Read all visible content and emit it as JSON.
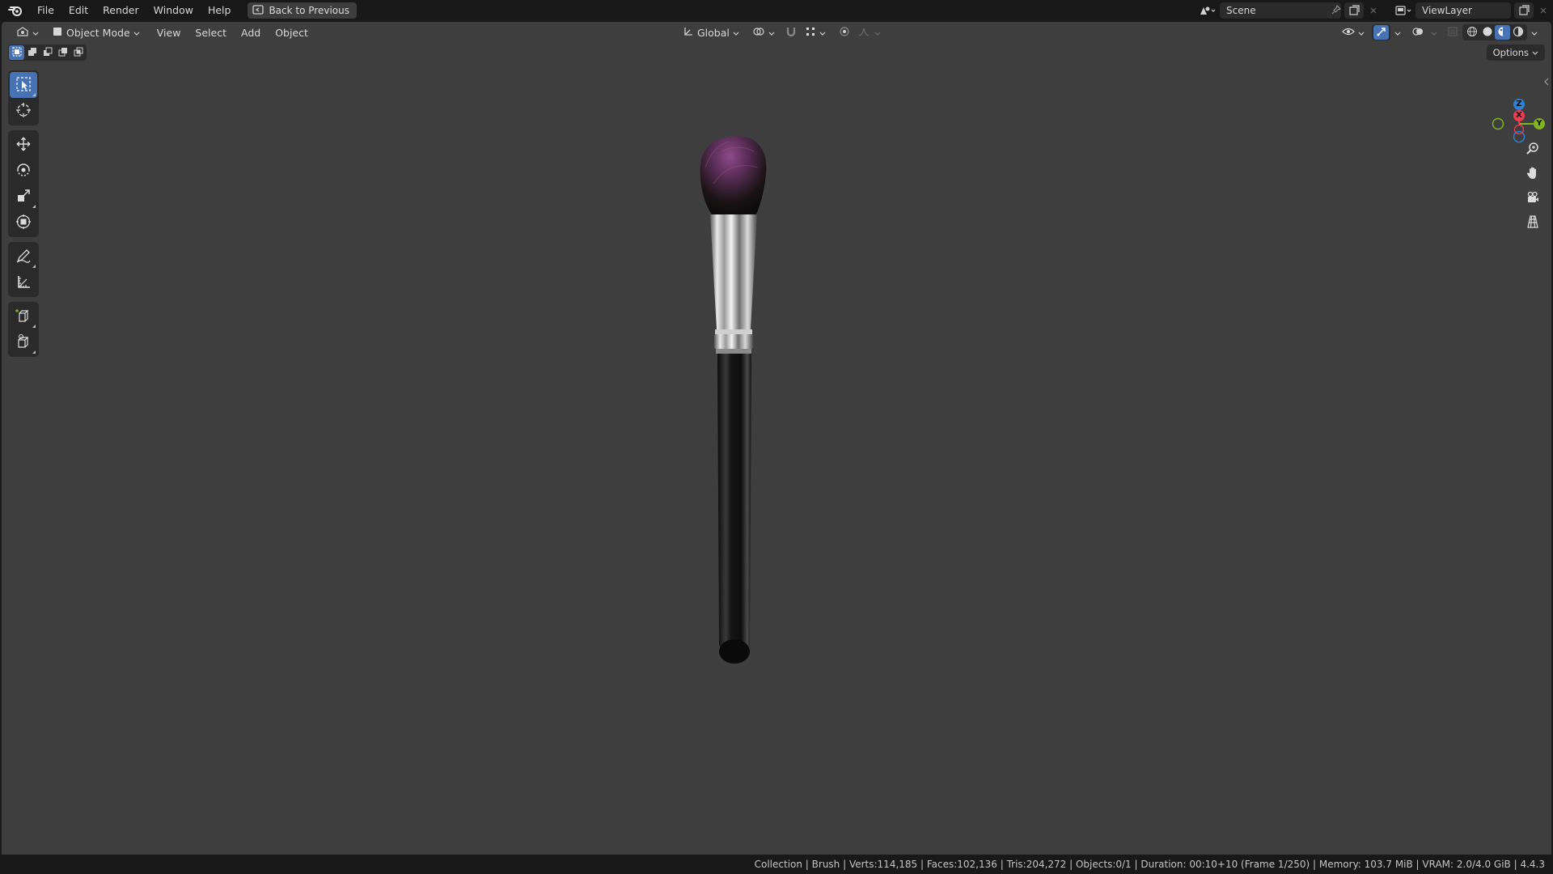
{
  "topbar": {
    "menus": [
      "File",
      "Edit",
      "Render",
      "Window",
      "Help"
    ],
    "back_label": "Back to Previous",
    "scene_name": "Scene",
    "view_layer": "ViewLayer"
  },
  "viewport_header": {
    "mode": "Object Mode",
    "menus": [
      "View",
      "Select",
      "Add",
      "Object"
    ],
    "transform_orientation": "Global",
    "options_label": "Options"
  },
  "gizmo": {
    "axis_x": "X",
    "axis_y": "Y",
    "axis_z": "Z",
    "colors": {
      "x": "#ee3b50",
      "y": "#7fb51f",
      "z": "#2f7fd6"
    }
  },
  "toolbar_tools": [
    "select-box",
    "cursor",
    "move",
    "rotate",
    "scale",
    "transform",
    "annotate",
    "measure",
    "add-cube",
    "add-extrude"
  ],
  "statusbar": {
    "text": "Collection | Brush | Verts:114,185 | Faces:102,136 | Tris:204,272 | Objects:0/1 | Duration: 00:10+10 (Frame 1/250) | Memory: 103.7 MiB | VRAM: 2.0/4.0 GiB | 4.4.3"
  },
  "colors": {
    "accent": "#4772b3",
    "viewport_bg": "#3e3e3e",
    "bar_bg": "#181818",
    "bristle": "#6e3a6b"
  }
}
